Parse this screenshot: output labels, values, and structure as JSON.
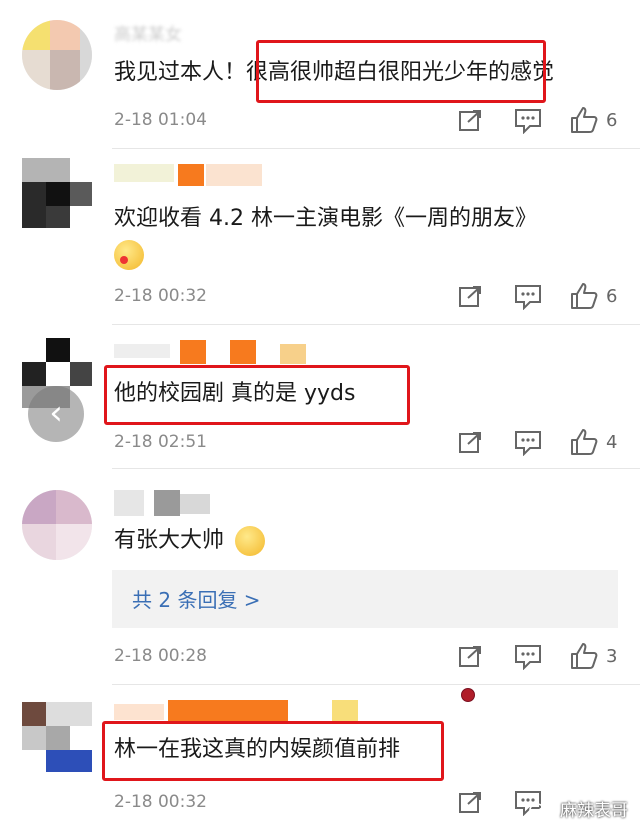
{
  "comments": [
    {
      "username": "高某某女",
      "text_plain": "我见过本人！",
      "text_highlight": "很高很帅超白很阳光少年",
      "text_tail": "的感觉",
      "time": "2-18 01:04",
      "likes": "6"
    },
    {
      "text": "欢迎收看 4.2 林一主演电影《一周的朋友》",
      "emoji": "shy-kiss-emoji",
      "time": "2-18 00:32",
      "likes": "6"
    },
    {
      "text": "他的校园剧 真的是 yyds",
      "time": "2-18 02:51",
      "likes": "4"
    },
    {
      "text": "有张大大帅",
      "emoji": "thinking-emoji",
      "time": "2-18 00:28",
      "likes": "3",
      "reply_link": "共 2 条回复 >"
    },
    {
      "text": "林一在我这真的内娱颜值前排",
      "time": "2-18 00:32"
    }
  ],
  "icons": {
    "share": "share-icon",
    "comment": "comment-icon",
    "like": "thumbs-up-icon",
    "back": "back-arrow-icon"
  },
  "watermark": "麻辣表哥",
  "colors": {
    "highlight_border": "#e0161b",
    "link": "#3a6fb5",
    "muted": "#8a8a8a"
  }
}
